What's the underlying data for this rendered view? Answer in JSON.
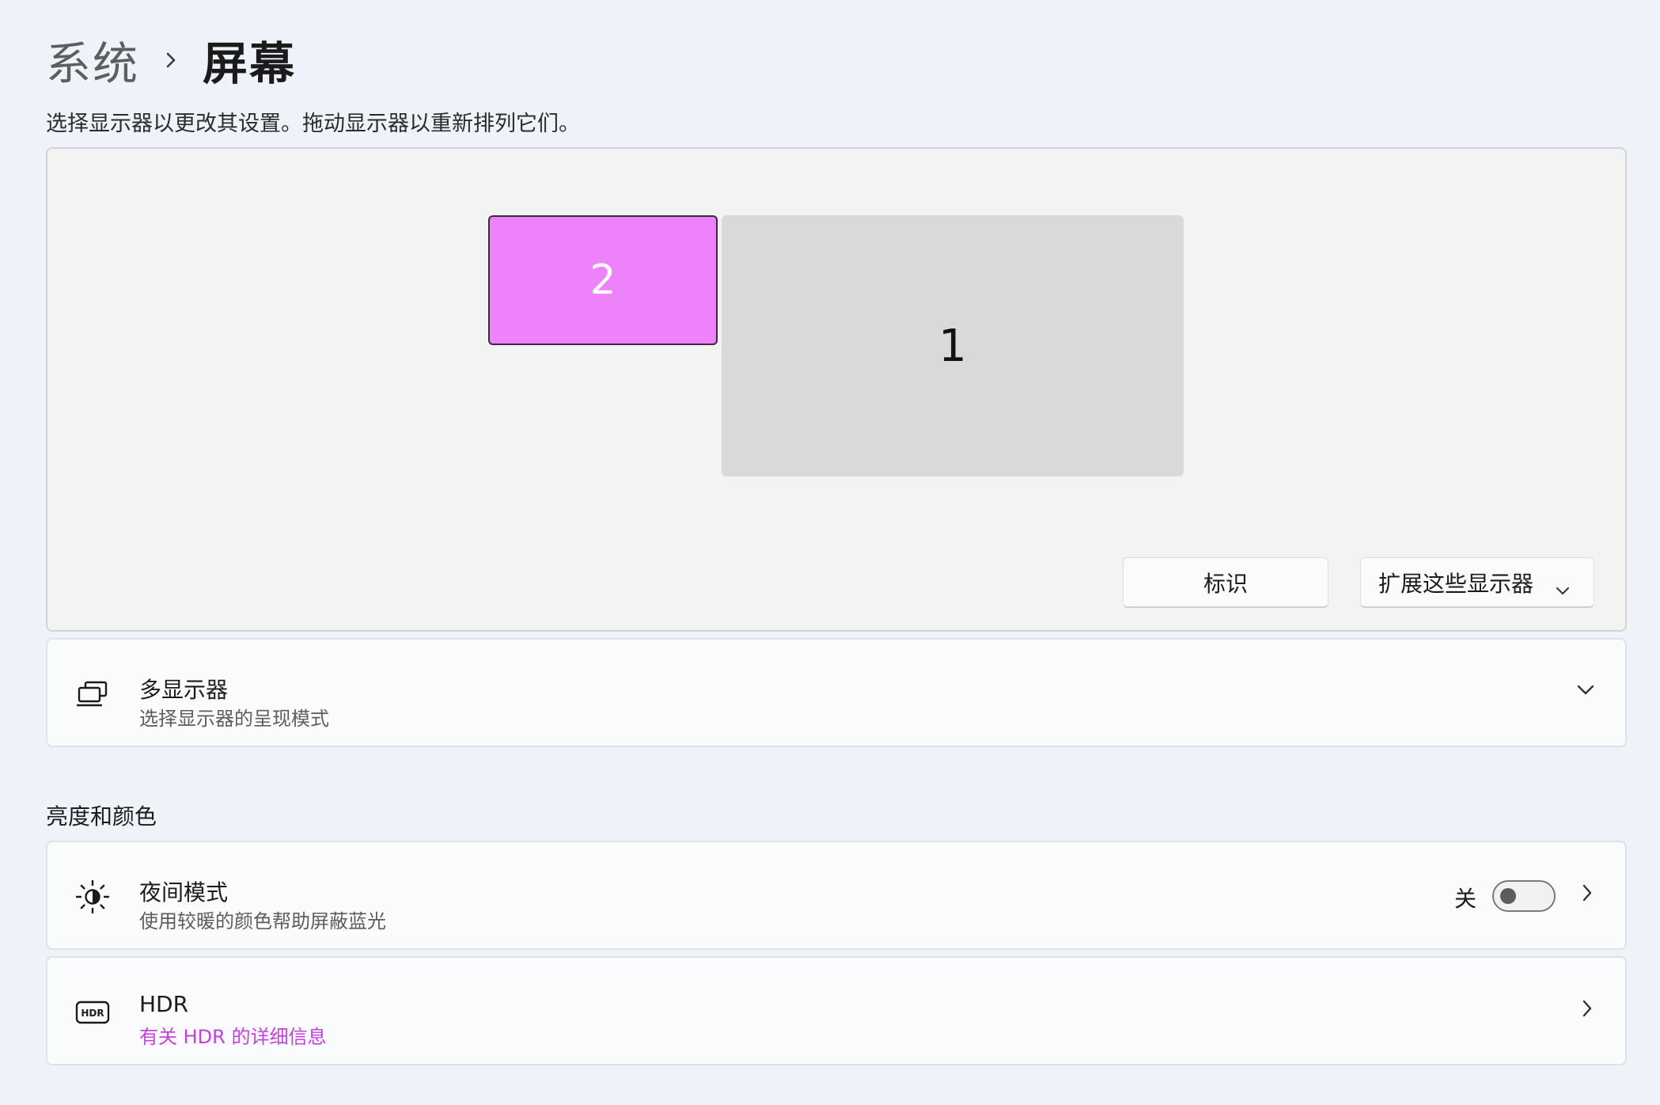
{
  "breadcrumb": {
    "parent": "系统",
    "separator_icon": "chevron-right-icon",
    "current": "屏幕"
  },
  "subtitle": "选择显示器以更改其设置。拖动显示器以重新排列它们。",
  "arrangement": {
    "monitors": [
      {
        "label": "2",
        "selected": true,
        "color": "#ee82fb"
      },
      {
        "label": "1",
        "selected": false,
        "color": "#d9d9d9"
      }
    ],
    "identify_label": "标识",
    "mode_select": {
      "value": "扩展这些显示器",
      "icon": "chevron-down-icon"
    }
  },
  "multi_display": {
    "icon": "multiple-monitors-icon",
    "title": "多显示器",
    "description": "选择显示器的呈现模式",
    "expand_icon": "chevron-down-icon"
  },
  "brightness_section": {
    "heading": "亮度和颜色"
  },
  "night_light": {
    "icon": "brightness-icon",
    "title": "夜间模式",
    "description": "使用较暖的颜色帮助屏蔽蓝光",
    "toggle_state_label": "关",
    "toggle_on": false,
    "nav_icon": "chevron-right-icon"
  },
  "hdr": {
    "icon": "hdr-icon",
    "title": "HDR",
    "link_text": "有关 HDR 的详细信息",
    "nav_icon": "chevron-right-icon"
  },
  "colors": {
    "accent": "#c640e0",
    "selected_monitor": "#ee82fb",
    "background": "#eff3f9"
  }
}
